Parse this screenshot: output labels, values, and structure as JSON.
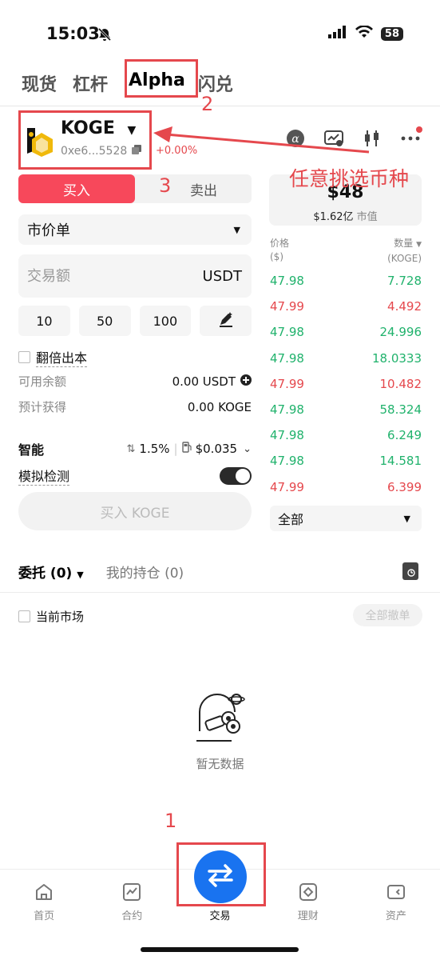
{
  "status": {
    "time": "15:03",
    "battery": "58"
  },
  "top_tabs": [
    {
      "label": "现货"
    },
    {
      "label": "杠杆"
    },
    {
      "label": "Alpha",
      "active": true
    },
    {
      "label": "闪兑"
    }
  ],
  "coin": {
    "symbol": "KOGE",
    "address": "0xe6...5528",
    "change": "+0.00%"
  },
  "market_card": {
    "price": "$48",
    "cap": "$1.62亿",
    "cap_label": "市值"
  },
  "trade_side": {
    "buy_label": "买入",
    "sell_label": "卖出"
  },
  "form": {
    "order_type": "市价单",
    "amount_placeholder": "交易额",
    "amount_unit": "USDT",
    "quick_amounts": [
      "10",
      "50",
      "100"
    ],
    "double_principal_label": "翻倍出本",
    "available_label": "可用余额",
    "available_value": "0.00 USDT",
    "estimated_label": "预计获得",
    "estimated_value": "0.00 KOGE",
    "smart_label": "智能",
    "slippage": "1.5%",
    "gas": "$0.035",
    "simulate_label": "模拟检测",
    "simulate_on": true,
    "submit_label": "买入 KOGE"
  },
  "order_book": {
    "price_header": "价格",
    "price_unit": "($)",
    "qty_header": "数量",
    "qty_unit": "(KOGE)",
    "rows": [
      {
        "price": "47.98",
        "qty": "7.728",
        "side": "green"
      },
      {
        "price": "47.99",
        "qty": "4.492",
        "side": "red"
      },
      {
        "price": "47.98",
        "qty": "24.996",
        "side": "green"
      },
      {
        "price": "47.98",
        "qty": "18.0333",
        "side": "green"
      },
      {
        "price": "47.99",
        "qty": "10.482",
        "side": "red"
      },
      {
        "price": "47.98",
        "qty": "58.324",
        "side": "green"
      },
      {
        "price": "47.98",
        "qty": "6.249",
        "side": "green"
      },
      {
        "price": "47.98",
        "qty": "14.581",
        "side": "green"
      },
      {
        "price": "47.99",
        "qty": "6.399",
        "side": "red"
      }
    ],
    "filter": "全部"
  },
  "orders": {
    "tab_open": "委托 (0)",
    "tab_positions": "我的持仓 (0)",
    "current_market_label": "当前市场",
    "cancel_all_label": "全部撤单",
    "empty_text": "暂无数据"
  },
  "bottom_nav": [
    {
      "label": "首页",
      "icon": "home-icon"
    },
    {
      "label": "合约",
      "icon": "futures-icon"
    },
    {
      "label": "交易",
      "icon": "swap-icon",
      "active": true
    },
    {
      "label": "理财",
      "icon": "earn-icon"
    },
    {
      "label": "资产",
      "icon": "wallet-icon"
    }
  ],
  "annotations": {
    "step1": "1",
    "step2": "2",
    "step3": "3",
    "note": "任意挑选币种",
    "color": "#e5484d"
  },
  "colors": {
    "buy": "#f7485b",
    "up": "#20b26c",
    "down": "#e5484d",
    "brand": "#1973f0"
  }
}
